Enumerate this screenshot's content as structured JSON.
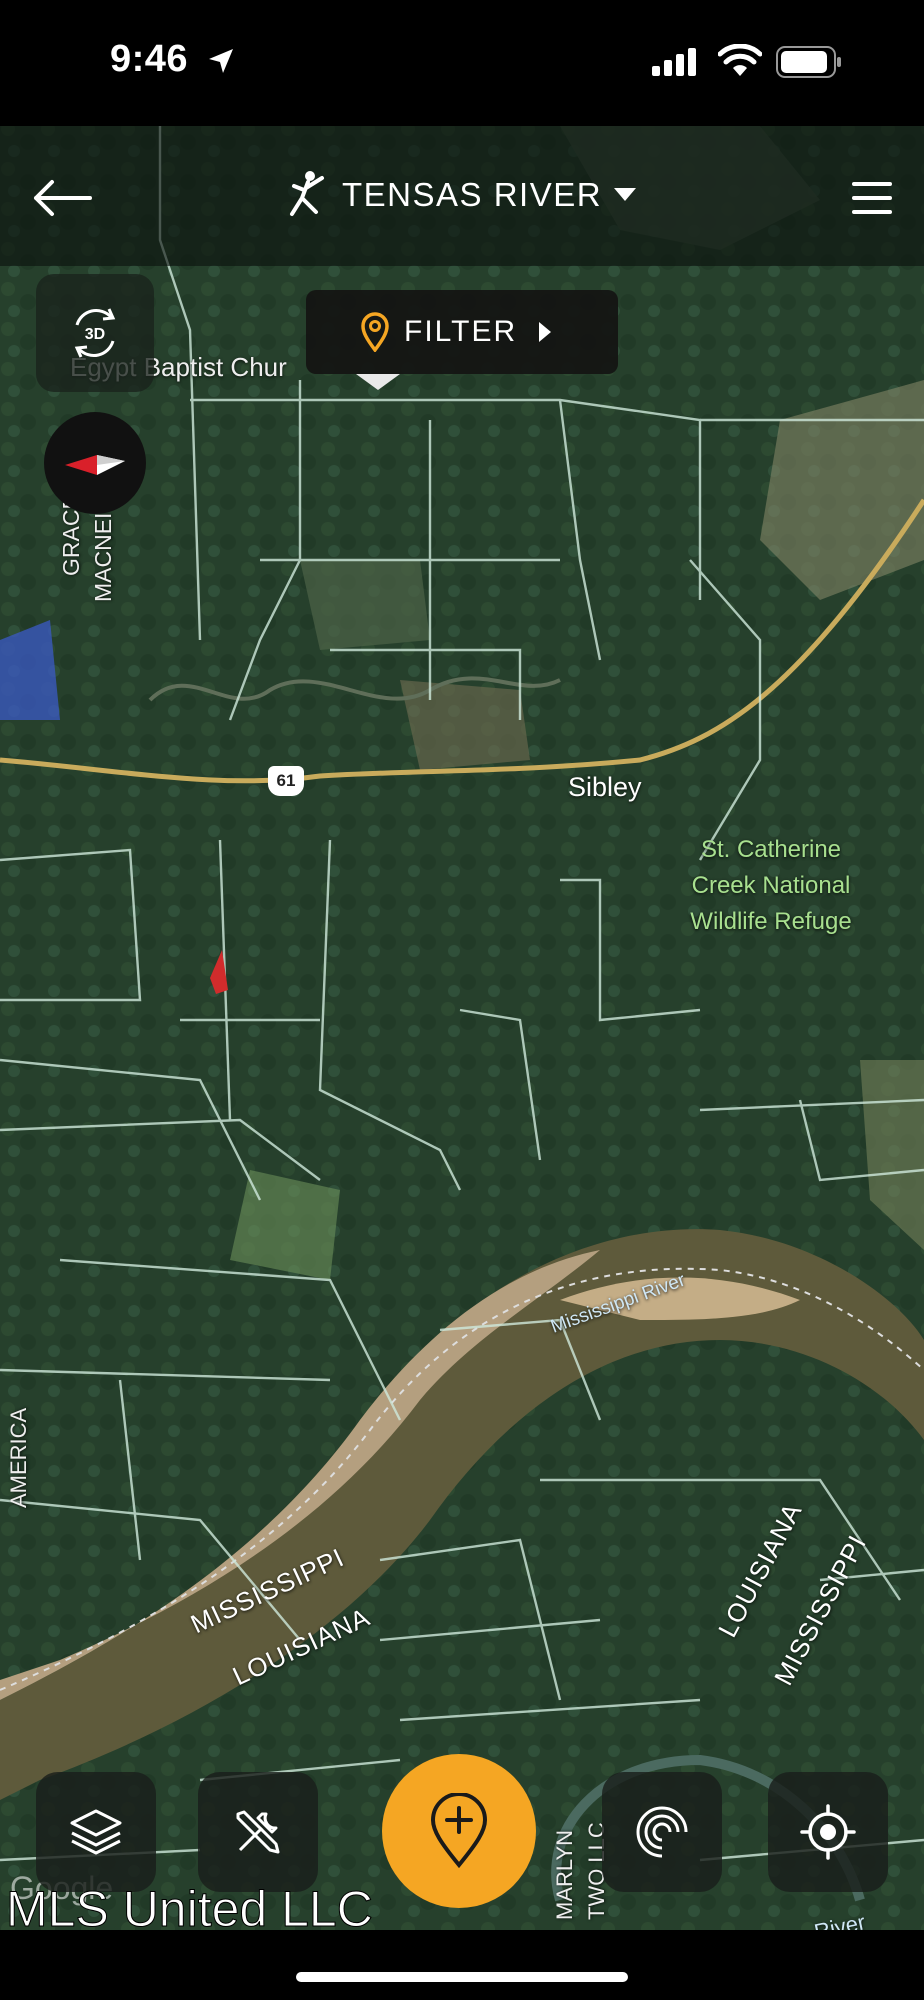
{
  "status_bar": {
    "time": "9:46",
    "icons": [
      "location-arrow-icon",
      "cellular-signal-icon",
      "wifi-icon",
      "battery-icon"
    ]
  },
  "header": {
    "back_icon": "back-arrow-icon",
    "brand_icon": "hunter-logo-icon",
    "title": "TENSAS RIVER",
    "dropdown_icon": "caret-down-icon",
    "menu_icon": "hamburger-menu-icon"
  },
  "filter": {
    "label": "FILTER",
    "icon": "map-pin-icon",
    "accent": "#f5a623"
  },
  "map_controls": {
    "view_3d_label": "3D",
    "compass_icon": "compass-icon"
  },
  "map_labels": {
    "church": "Egypt Baptist Chur",
    "grace": "GRACE M",
    "macnei": "MACNEI",
    "highway": "61",
    "town": "Sibley",
    "refuge": "St. Catherine Creek National Wildlife Refuge",
    "river": "Mississippi River",
    "state_ms_left": "MISSISSIPPI",
    "state_la_left": "LOUISIANA",
    "state_la_right": "LOUISIANA",
    "state_ms_right": "MISSISSIPPI",
    "america": "AMERICA",
    "marlyn": "MARLYN",
    "llc": "TWO LLC",
    "river_bottom": "River",
    "google": "Google"
  },
  "toolbar": {
    "layers_icon": "layers-icon",
    "tools_icon": "tools-icon",
    "add_pin_icon": "add-pin-icon",
    "rings_icon": "range-rings-icon",
    "locate_icon": "locate-icon"
  },
  "watermark": "MLS United LLC",
  "colors": {
    "accent": "#f5a623",
    "parcel_lines": "#cfe9dc",
    "refuge_label": "#a8e08f"
  }
}
